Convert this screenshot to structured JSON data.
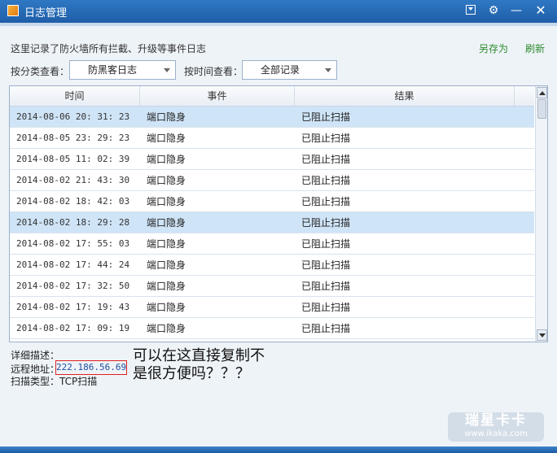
{
  "window": {
    "title": "日志管理"
  },
  "description": "这里记录了防火墙所有拦截、升级等事件日志",
  "actions": {
    "save_as": "另存为",
    "refresh": "刷新"
  },
  "filters": {
    "category_label": "按分类查看：",
    "category_value": "防黑客日志",
    "time_label": "按时间查看：",
    "time_value": "全部记录"
  },
  "table": {
    "columns": [
      "时间",
      "事件",
      "结果"
    ],
    "rows": [
      {
        "time": "2014-08-06 20: 31: 23",
        "event": "端口隐身",
        "result": "已阻止扫描",
        "selected": true
      },
      {
        "time": "2014-08-05 23: 29: 23",
        "event": "端口隐身",
        "result": "已阻止扫描",
        "selected": false
      },
      {
        "time": "2014-08-05 11: 02: 39",
        "event": "端口隐身",
        "result": "已阻止扫描",
        "selected": false
      },
      {
        "time": "2014-08-02 21: 43: 30",
        "event": "端口隐身",
        "result": "已阻止扫描",
        "selected": false
      },
      {
        "time": "2014-08-02 18: 42: 03",
        "event": "端口隐身",
        "result": "已阻止扫描",
        "selected": false
      },
      {
        "time": "2014-08-02 18: 29: 28",
        "event": "端口隐身",
        "result": "已阻止扫描",
        "selected": true
      },
      {
        "time": "2014-08-02 17: 55: 03",
        "event": "端口隐身",
        "result": "已阻止扫描",
        "selected": false
      },
      {
        "time": "2014-08-02 17: 44: 24",
        "event": "端口隐身",
        "result": "已阻止扫描",
        "selected": false
      },
      {
        "time": "2014-08-02 17: 32: 50",
        "event": "端口隐身",
        "result": "已阻止扫描",
        "selected": false
      },
      {
        "time": "2014-08-02 17: 19: 43",
        "event": "端口隐身",
        "result": "已阻止扫描",
        "selected": false
      },
      {
        "time": "2014-08-02 17: 09: 19",
        "event": "端口隐身",
        "result": "已阻止扫描",
        "selected": false
      }
    ]
  },
  "detail": {
    "title": "详细描述：",
    "remote_label": "远程地址：",
    "remote_value": "222.186.56.69",
    "scan_label": "扫描类型：",
    "scan_value": "TCP扫描"
  },
  "annotation": "可以在这直接复制不\n是很方便吗？？？",
  "watermark": {
    "brand": "瑞星卡卡",
    "url": "www.ikaka.com"
  },
  "colors": {
    "titlebar": "#2f78c4",
    "selected_row": "#cfe4f7",
    "link": "#2d8b2d",
    "highlight_border": "#e02020"
  }
}
